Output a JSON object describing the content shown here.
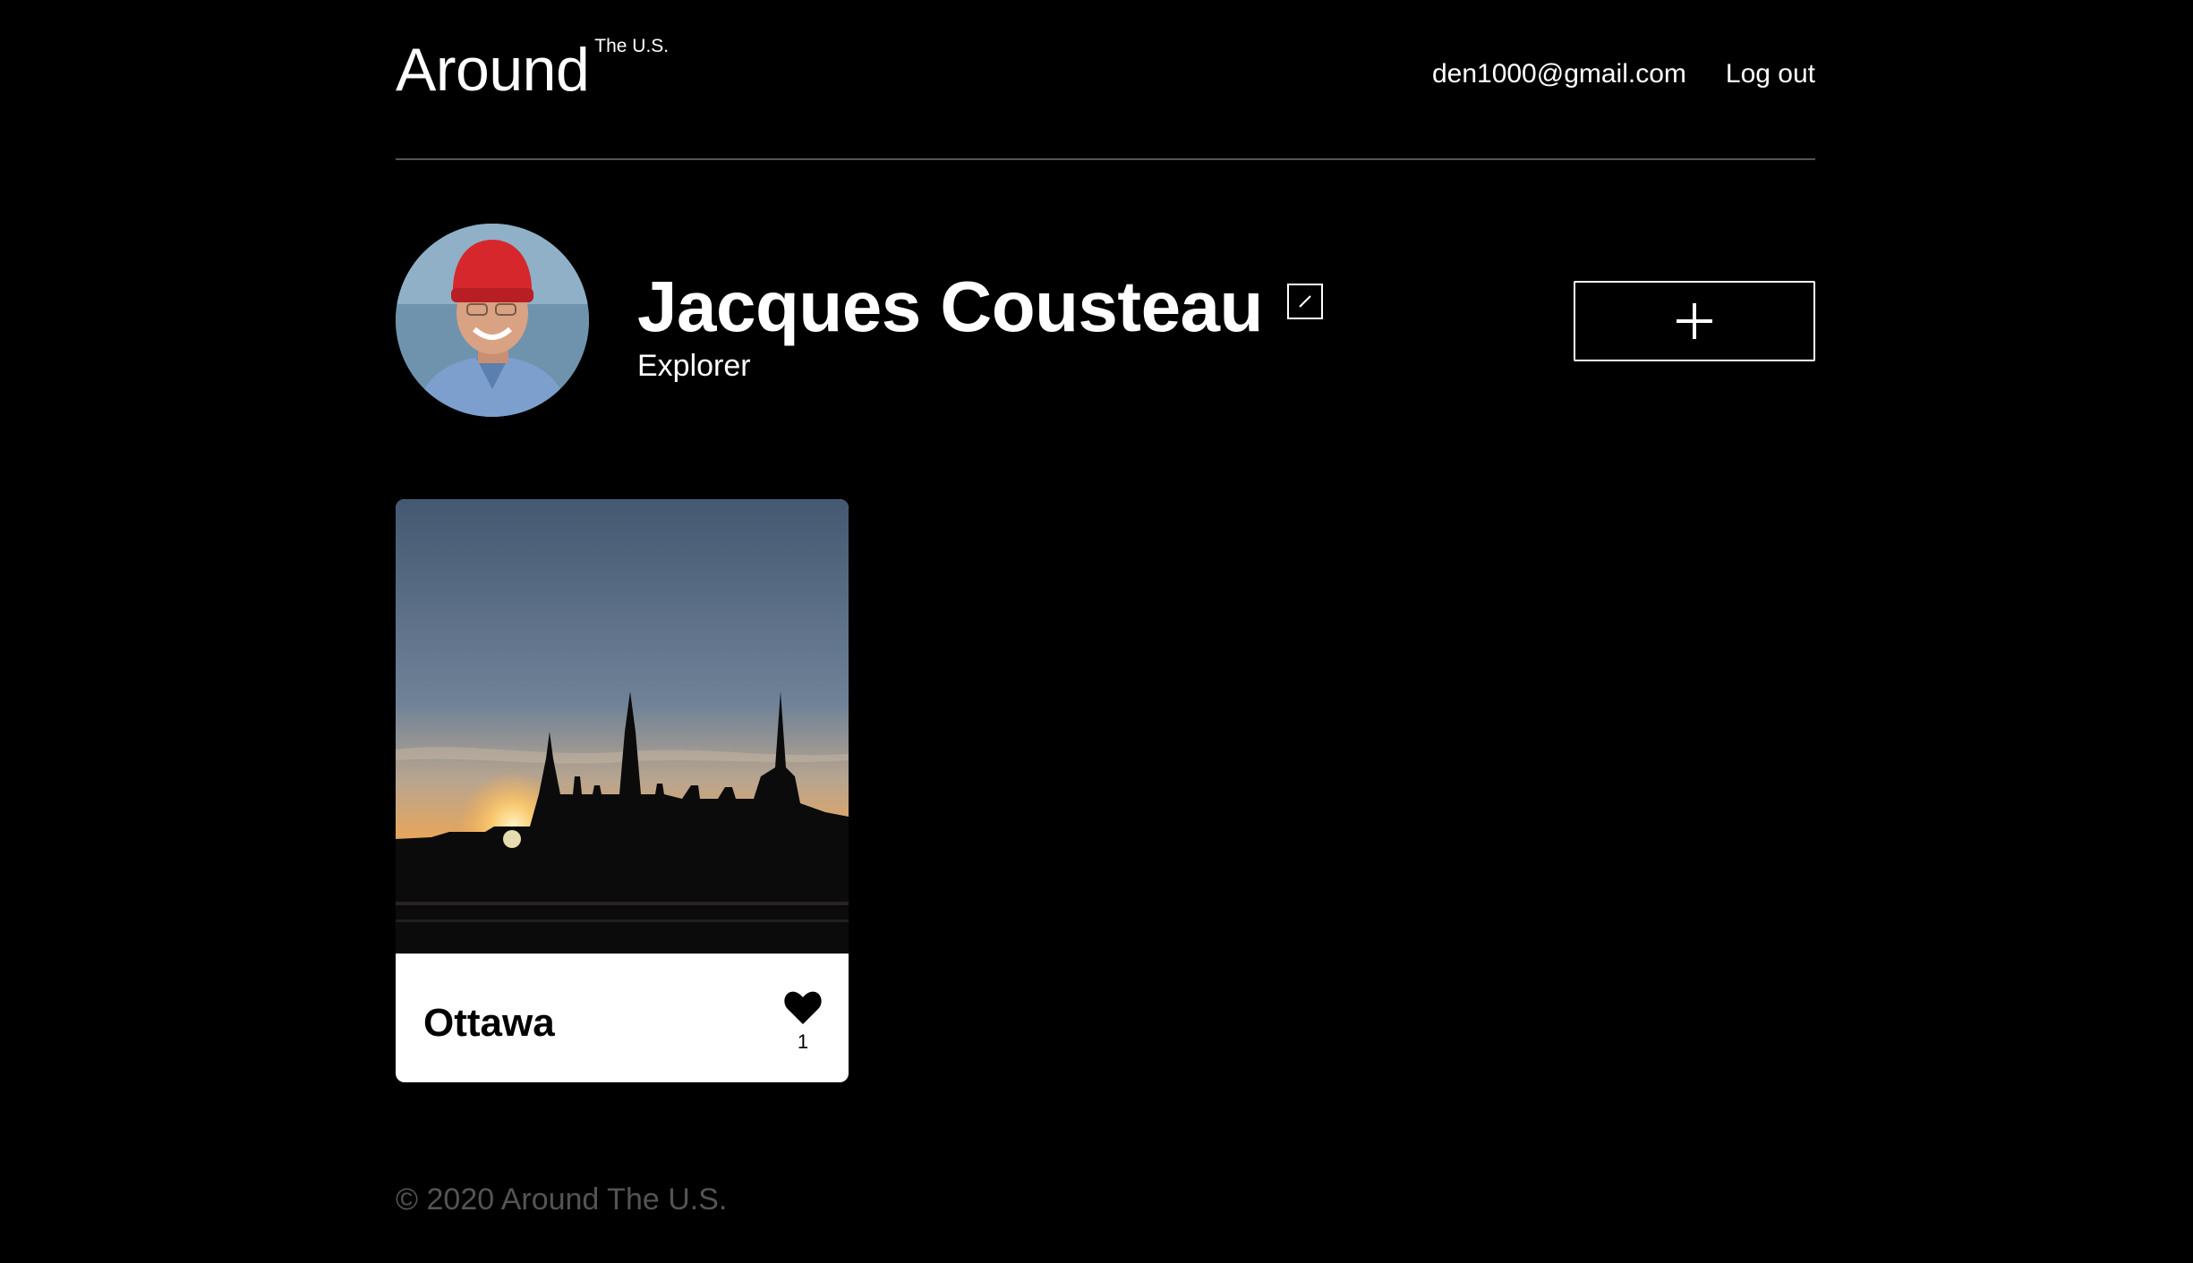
{
  "header": {
    "logo_main": "Around",
    "logo_sup": "The U.S.",
    "user_email": "den1000@gmail.com",
    "logout_label": "Log out"
  },
  "profile": {
    "name": "Jacques Cousteau",
    "about": "Explorer",
    "avatar_icon": "avatar-photo",
    "edit_icon": "pencil-icon",
    "add_icon": "plus-icon"
  },
  "cards": [
    {
      "title": "Ottawa",
      "likes": "1",
      "like_icon": "heart-icon"
    }
  ],
  "footer": {
    "copyright": "© 2020 Around The U.S."
  },
  "colors": {
    "background": "#000000",
    "text": "#ffffff",
    "divider": "#545454",
    "footer_text": "#545454",
    "card_caption_bg": "#ffffff"
  }
}
